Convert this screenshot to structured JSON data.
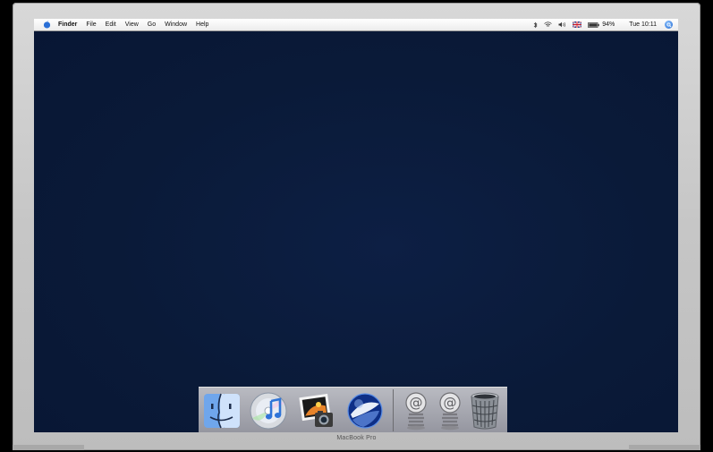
{
  "device": {
    "label": "MacBook Pro"
  },
  "menubar": {
    "apple_icon": "apple-icon",
    "items": [
      {
        "label": "Finder"
      },
      {
        "label": "File"
      },
      {
        "label": "Edit"
      },
      {
        "label": "View"
      },
      {
        "label": "Go"
      },
      {
        "label": "Window"
      },
      {
        "label": "Help"
      }
    ],
    "status": {
      "battery_percent": "94%",
      "clock": "Tue 10:11",
      "icons": [
        "bluetooth-icon",
        "wifi-icon",
        "volume-icon",
        "uk-flag-icon",
        "battery-icon",
        "spotlight-icon"
      ]
    }
  },
  "desktop": {
    "background_color": "#0a1a38"
  },
  "dock": {
    "items": [
      {
        "name": "Finder",
        "icon": "finder-icon"
      },
      {
        "name": "iTunes",
        "icon": "itunes-icon"
      },
      {
        "name": "iPhoto",
        "icon": "iphoto-icon"
      },
      {
        "name": "Google Earth",
        "icon": "google-earth-icon"
      },
      {
        "name": "Mail spring 1",
        "icon": "at-spring-icon"
      },
      {
        "name": "Mail spring 2",
        "icon": "at-spring-icon"
      },
      {
        "name": "Trash",
        "icon": "trash-icon"
      }
    ]
  }
}
